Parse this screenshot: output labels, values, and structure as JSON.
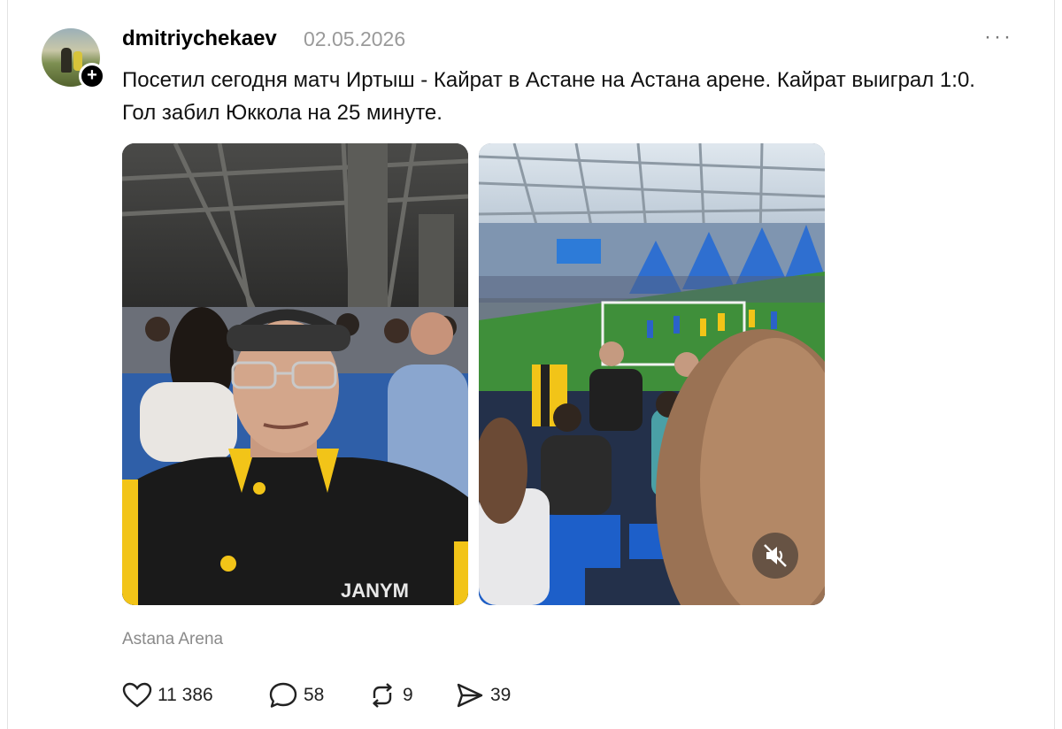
{
  "post": {
    "username": "dmitriychekaev",
    "date": "02.05.2026",
    "more_label": "···",
    "follow_label": "+",
    "text": "Посетил сегодня матч Иртыш - Кайрат в Астане на Астана арене. Кайрат выиграл 1:0. Гол забил Юккола на 25 минуте.",
    "location": "Astana Arena",
    "jacket_brand": "JANYM",
    "actions": {
      "likes": "11 386",
      "comments": "58",
      "reposts": "9",
      "shares": "39"
    }
  },
  "icons": {
    "like": "heart-icon",
    "comment": "comment-bubble-icon",
    "repost": "repost-icon",
    "share": "share-send-icon",
    "mute": "speaker-muted-icon",
    "follow": "plus-icon"
  },
  "colors": {
    "kairat_yellow": "#f2c418",
    "seat_blue": "#1d5fc9",
    "pitch_green": "#3f8f3a",
    "muted_text": "#9a9a9a"
  }
}
